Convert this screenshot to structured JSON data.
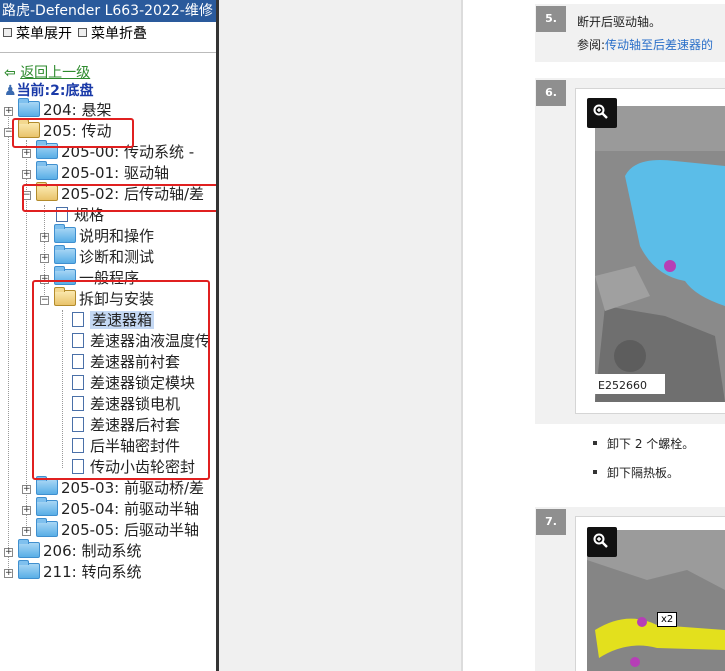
{
  "window_title": "路虎-Defender L663-2022-维修",
  "menu": {
    "expand_label": "菜单展开",
    "collapse_label": "菜单折叠"
  },
  "nav": {
    "back_label": "返回上一级",
    "current_label": "当前:2:底盘"
  },
  "tree": {
    "n204": "204: 悬架",
    "n205": "205: 传动",
    "n205_00": "205-00: 传动系统 -",
    "n205_01": "205-01: 驱动轴",
    "n205_02": "205-02: 后传动轴/差",
    "spec": "规格",
    "desc": "说明和操作",
    "diag": "诊断和测试",
    "general": "一般程序",
    "removal": "拆卸与安装",
    "items": [
      "差速器箱",
      "差速器油液温度传",
      "差速器前衬套",
      "差速器锁定模块",
      "差速器锁电机",
      "差速器后衬套",
      "后半轴密封件",
      "传动小齿轮密封"
    ],
    "n205_03": "205-03: 前驱动桥/差",
    "n205_04": "205-04: 前驱动半轴",
    "n205_05": "205-05: 后驱动半轴",
    "n206": "206: 制动系统",
    "n211": "211: 转向系统"
  },
  "content": {
    "step5": {
      "num": "5.",
      "text": "断开后驱动轴。",
      "ref_prefix": "参阅:",
      "ref_link": "传动轴至后差速器的"
    },
    "step6": {
      "num": "6.",
      "figure_id": "E252660",
      "bullets": [
        "卸下 2 个螺栓。",
        "卸下隔热板。"
      ]
    },
    "step7": {
      "num": "7.",
      "callout": "x2"
    }
  },
  "colors": {
    "title_bar": "#2a5a9c",
    "highlight_box": "#e02020",
    "link": "#2a6fc9",
    "current_node": "#1a3aa8"
  }
}
